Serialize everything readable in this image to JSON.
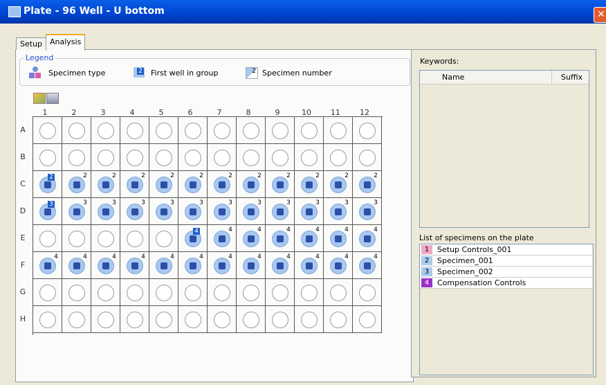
{
  "window": {
    "title": "Plate - 96 Well - U bottom"
  },
  "tabs": [
    {
      "label": "Setup"
    },
    {
      "label": "Analysis"
    }
  ],
  "legend": {
    "title": "Legend",
    "specimen_type": "Specimen type",
    "first_well": "First well in group",
    "first_well_num": "2",
    "specimen_number": "Specimen number",
    "specimen_number_num": "2"
  },
  "plate": {
    "columns": [
      "1",
      "2",
      "3",
      "4",
      "5",
      "6",
      "7",
      "8",
      "9",
      "10",
      "11",
      "12"
    ],
    "rows": [
      {
        "label": "A",
        "wells": [
          "",
          "",
          "",
          "",
          "",
          "",
          "",
          "",
          "",
          "",
          "",
          ""
        ],
        "first": []
      },
      {
        "label": "B",
        "wells": [
          "",
          "",
          "",
          "",
          "",
          "",
          "",
          "",
          "",
          "",
          "",
          ""
        ],
        "first": []
      },
      {
        "label": "C",
        "wells": [
          "2",
          "2",
          "2",
          "2",
          "2",
          "2",
          "2",
          "2",
          "2",
          "2",
          "2",
          "2"
        ],
        "first": [
          0
        ]
      },
      {
        "label": "D",
        "wells": [
          "3",
          "3",
          "3",
          "3",
          "3",
          "3",
          "3",
          "3",
          "3",
          "3",
          "3",
          "3"
        ],
        "first": [
          0
        ]
      },
      {
        "label": "E",
        "wells": [
          "",
          "",
          "",
          "",
          "",
          "4",
          "4",
          "4",
          "4",
          "4",
          "4",
          "4"
        ],
        "first": [
          5
        ]
      },
      {
        "label": "F",
        "wells": [
          "4",
          "4",
          "4",
          "4",
          "4",
          "4",
          "4",
          "4",
          "4",
          "4",
          "4",
          "4"
        ],
        "first": []
      },
      {
        "label": "G",
        "wells": [
          "",
          "",
          "",
          "",
          "",
          "",
          "",
          "",
          "",
          "",
          "",
          ""
        ],
        "first": []
      },
      {
        "label": "H",
        "wells": [
          "",
          "",
          "",
          "",
          "",
          "",
          "",
          "",
          "",
          "",
          "",
          ""
        ],
        "first": []
      }
    ]
  },
  "keywords": {
    "label": "Keywords:",
    "col_name": "Name",
    "col_suffix": "Suffix"
  },
  "specimens": {
    "label": "List of specimens on the plate",
    "items": [
      {
        "num": "1",
        "name": "Setup Controls_001",
        "color": "#F2A7C3"
      },
      {
        "num": "2",
        "name": "Specimen_001",
        "color": "#A9CBEF"
      },
      {
        "num": "3",
        "name": "Specimen_002",
        "color": "#A9CBEF"
      },
      {
        "num": "4",
        "name": "Compensation Controls",
        "color": "#9B2FC9"
      }
    ]
  }
}
